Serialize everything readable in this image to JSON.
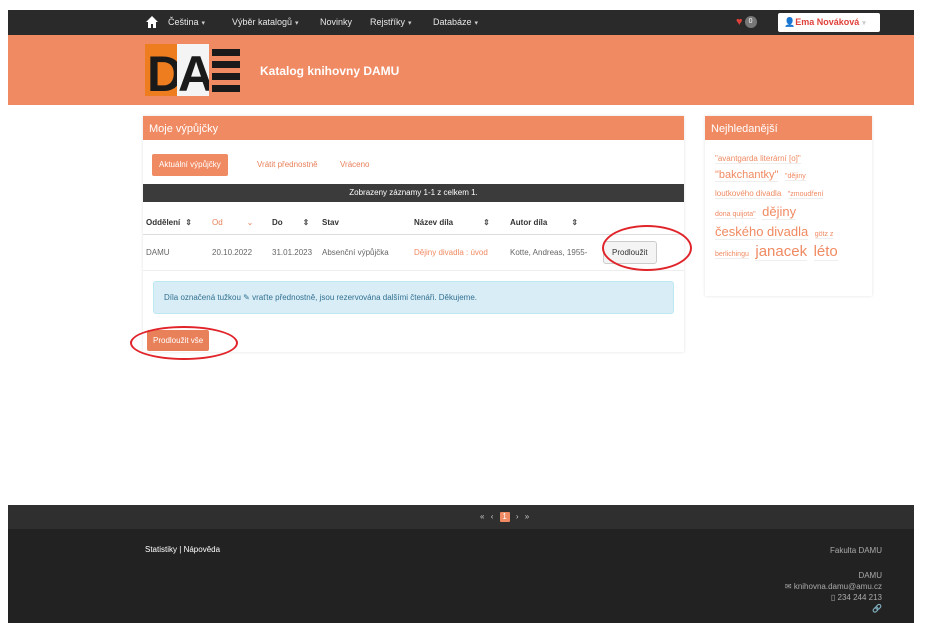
{
  "nav": {
    "items": [
      {
        "label": "Čeština",
        "dropdown": true
      },
      {
        "label": "Výběr katalogů",
        "dropdown": true
      },
      {
        "label": "Novinky",
        "dropdown": false
      },
      {
        "label": "Rejstříky",
        "dropdown": true
      },
      {
        "label": "Databáze",
        "dropdown": true
      }
    ],
    "favorites_count": "0",
    "user": "Ema Nováková"
  },
  "header": {
    "logo_text": "DAMU",
    "title": "Katalog knihovny DAMU"
  },
  "loans": {
    "panel_title": "Moje výpůjčky",
    "tabs": [
      "Aktuální výpůjčky",
      "Vrátit přednostně",
      "Vráceno"
    ],
    "count_text": "Zobrazeny záznamy 1-1 z celkem 1.",
    "columns": [
      "Oddělení",
      "Od",
      "Do",
      "Stav",
      "Název díla",
      "Autor díla"
    ],
    "rows": [
      {
        "department": "DAMU",
        "from": "20.10.2022",
        "to": "31.01.2023",
        "status": "Absenční výpůjčka",
        "title": "Dějiny divadla : úvod",
        "author": "Kotte, Andreas, 1955-",
        "action": "Prodloužit"
      }
    ],
    "info_before": "Díla označená tužkou",
    "info_after": "vraťte přednostně, jsou rezervována dalšími čtenáři. Děkujeme.",
    "renew_all": "Prodloužit vše"
  },
  "sidebar": {
    "title": "Nejhledanější",
    "tags": [
      {
        "text": "\"avantgarda literární [o]\"",
        "size": "s"
      },
      {
        "text": "\"bakchantky\"",
        "size": "m"
      },
      {
        "text": "\"dějiny",
        "size": "s"
      },
      {
        "text": "loutkového divadla",
        "size": "s"
      },
      {
        "text": "\"zmoudření",
        "size": "s"
      },
      {
        "text": "dona quijota\"",
        "size": "s"
      },
      {
        "text": "dějiny",
        "size": "l"
      },
      {
        "text": "českého divadla",
        "size": "l"
      },
      {
        "text": "götz z",
        "size": "s"
      },
      {
        "text": "berlichingu",
        "size": "s"
      },
      {
        "text": "janacek",
        "size": "xl"
      },
      {
        "text": "léto",
        "size": "xl"
      }
    ]
  },
  "pager": {
    "current": "1"
  },
  "footer": {
    "links": [
      "Statistiky",
      "Nápověda"
    ],
    "org": "Fakulta DAMU",
    "org_short": "DAMU",
    "email": "knihovna.damu@amu.cz",
    "phone": "234 244 213"
  },
  "colors": {
    "accent": "#f08a62",
    "dark": "#2a2a2a",
    "annotation": "#e0242a"
  }
}
